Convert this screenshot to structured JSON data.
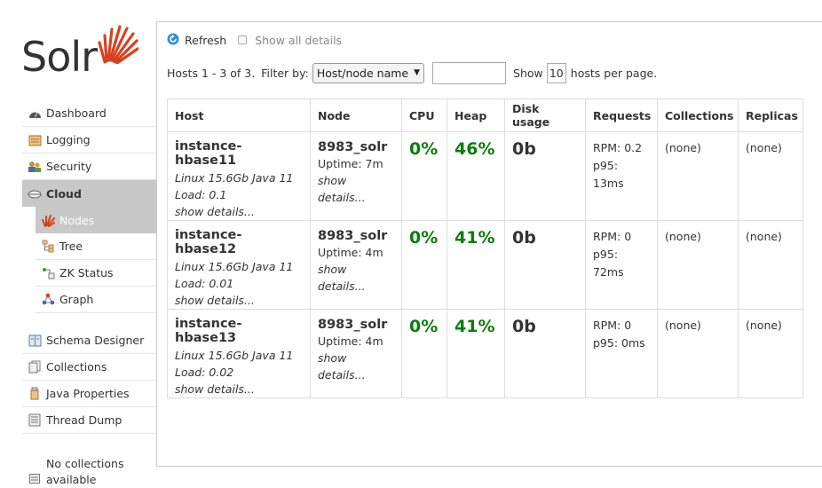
{
  "logo": {
    "text": "Solr",
    "accent": "#d9411e"
  },
  "sidebar": {
    "items": [
      {
        "name": "sidebar-item-dashboard",
        "icon": "dashboard-icon",
        "label": "Dashboard"
      },
      {
        "name": "sidebar-item-logging",
        "icon": "logging-icon",
        "label": "Logging"
      },
      {
        "name": "sidebar-item-security",
        "icon": "security-icon",
        "label": "Security"
      },
      {
        "name": "sidebar-item-cloud",
        "icon": "cloud-icon",
        "label": "Cloud"
      }
    ],
    "cloud_sub": [
      {
        "name": "sidebar-item-nodes",
        "icon": "nodes-icon",
        "label": "Nodes"
      },
      {
        "name": "sidebar-item-tree",
        "icon": "tree-icon",
        "label": "Tree"
      },
      {
        "name": "sidebar-item-zk-status",
        "icon": "zk-status-icon",
        "label": "ZK Status"
      },
      {
        "name": "sidebar-item-graph",
        "icon": "graph-icon",
        "label": "Graph"
      }
    ],
    "items2": [
      {
        "name": "sidebar-item-schema-designer",
        "icon": "schema-designer-icon",
        "label": "Schema Designer"
      },
      {
        "name": "sidebar-item-collections",
        "icon": "collections-icon",
        "label": "Collections"
      },
      {
        "name": "sidebar-item-java-properties",
        "icon": "java-properties-icon",
        "label": "Java Properties"
      },
      {
        "name": "sidebar-item-thread-dump",
        "icon": "thread-dump-icon",
        "label": "Thread Dump"
      }
    ],
    "no_collections": "No collections available"
  },
  "toolbar": {
    "refresh_label": "Refresh",
    "show_all_label": "Show all details",
    "hosts_summary": "Hosts 1 - 3 of 3.",
    "filter_by_label": "Filter by:",
    "filter_select_value": "Host/node name",
    "filter_input_value": "",
    "show_label": "Show",
    "per_page_value": "10",
    "per_page_suffix": "hosts per page."
  },
  "table": {
    "headers": [
      "Host",
      "Node",
      "CPU",
      "Heap",
      "Disk usage",
      "Requests",
      "Collections",
      "Replicas"
    ],
    "rows": [
      {
        "host": "instance-hbase11",
        "host_info": "Linux 15.6Gb Java 11",
        "load": "Load: 0.1",
        "host_details": "show details...",
        "node": "8983_solr",
        "uptime": "Uptime: 7m",
        "node_details": "show details...",
        "cpu": "0%",
        "heap": "46%",
        "disk": "0b",
        "rpm": "RPM: 0.2",
        "p95": "p95: 13ms",
        "collections": "(none)",
        "replicas": "(none)"
      },
      {
        "host": "instance-hbase12",
        "host_info": "Linux 15.6Gb Java 11",
        "load": "Load: 0.01",
        "host_details": "show details...",
        "node": "8983_solr",
        "uptime": "Uptime: 4m",
        "node_details": "show details...",
        "cpu": "0%",
        "heap": "41%",
        "disk": "0b",
        "rpm": "RPM: 0",
        "p95": "p95: 72ms",
        "collections": "(none)",
        "replicas": "(none)"
      },
      {
        "host": "instance-hbase13",
        "host_info": "Linux 15.6Gb Java 11",
        "load": "Load: 0.02",
        "host_details": "show details...",
        "node": "8983_solr",
        "uptime": "Uptime: 4m",
        "node_details": "show details...",
        "cpu": "0%",
        "heap": "41%",
        "disk": "0b",
        "rpm": "RPM: 0",
        "p95": "p95: 0ms",
        "collections": "(none)",
        "replicas": "(none)"
      }
    ]
  }
}
